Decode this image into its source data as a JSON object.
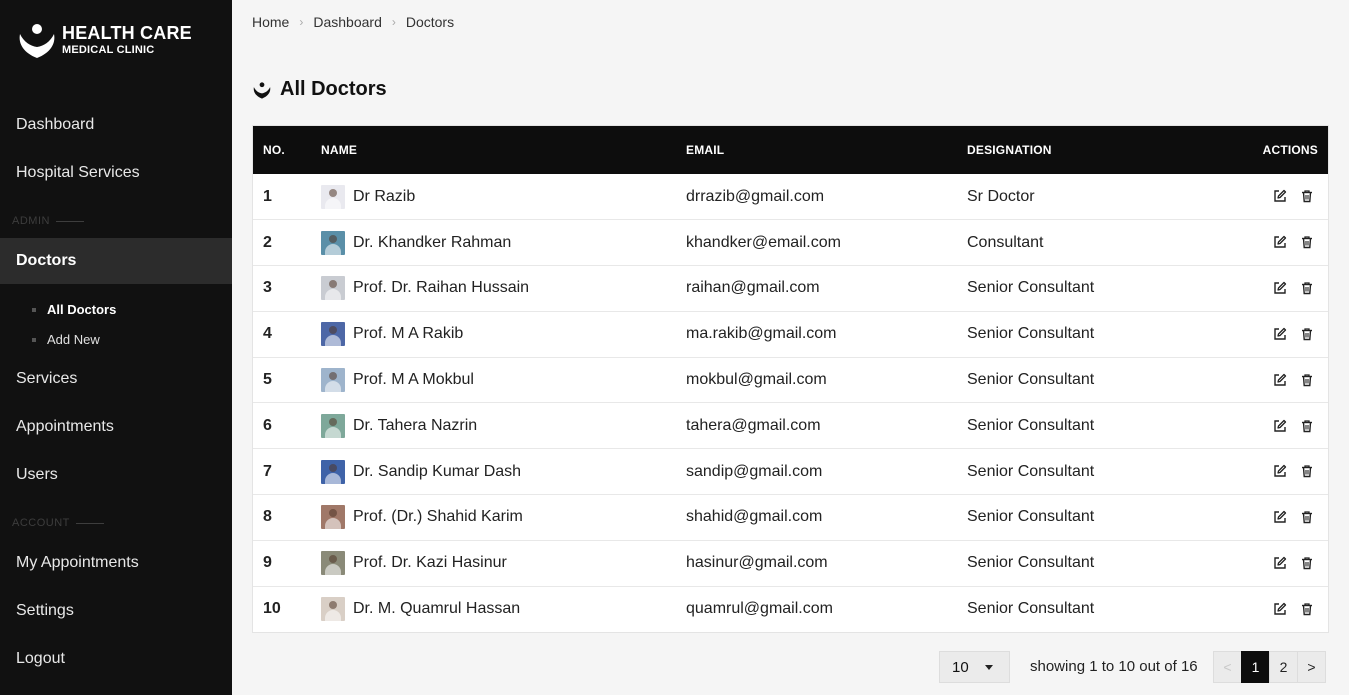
{
  "brand": {
    "title": "HEALTH CARE",
    "subtitle": "MEDICAL CLINIC"
  },
  "sidebar": {
    "items": [
      {
        "label": "Dashboard"
      },
      {
        "label": "Hospital Services"
      },
      {
        "section": "ADMIN"
      },
      {
        "label": "Doctors",
        "active": true
      },
      {
        "label": "Services"
      },
      {
        "label": "Appointments"
      },
      {
        "label": "Users"
      },
      {
        "section": "ACCOUNT"
      },
      {
        "label": "My Appointments"
      },
      {
        "label": "Settings"
      },
      {
        "label": "Logout"
      }
    ],
    "sub_items": [
      {
        "label": "All Doctors",
        "active": true
      },
      {
        "label": "Add New"
      }
    ]
  },
  "breadcrumb": [
    "Home",
    "Dashboard",
    "Doctors"
  ],
  "page": {
    "title": "All Doctors"
  },
  "table": {
    "headers": {
      "no": "NO.",
      "name": "NAME",
      "email": "EMAIL",
      "designation": "DESIGNATION",
      "actions": "ACTIONS"
    },
    "rows": [
      {
        "no": "1",
        "name": "Dr Razib",
        "email": "drrazib@gmail.com",
        "designation": "Sr Doctor",
        "avatar_color": "#e9e9ef"
      },
      {
        "no": "2",
        "name": "Dr. Khandker Rahman",
        "email": "khandker@email.com",
        "designation": "Consultant",
        "avatar_color": "#5a8fa8"
      },
      {
        "no": "3",
        "name": "Prof. Dr. Raihan Hussain",
        "email": "raihan@gmail.com",
        "designation": "Senior Consultant",
        "avatar_color": "#c9ccd2"
      },
      {
        "no": "4",
        "name": "Prof. M A Rakib",
        "email": "ma.rakib@gmail.com",
        "designation": "Senior Consultant",
        "avatar_color": "#4d67a6"
      },
      {
        "no": "5",
        "name": "Prof. M A Mokbul",
        "email": "mokbul@gmail.com",
        "designation": "Senior Consultant",
        "avatar_color": "#9eb4cc"
      },
      {
        "no": "6",
        "name": "Dr. Tahera Nazrin",
        "email": "tahera@gmail.com",
        "designation": "Senior Consultant",
        "avatar_color": "#7ea89a"
      },
      {
        "no": "7",
        "name": "Dr. Sandip Kumar Dash",
        "email": "sandip@gmail.com",
        "designation": "Senior Consultant",
        "avatar_color": "#3f63a8"
      },
      {
        "no": "8",
        "name": "Prof. (Dr.) Shahid Karim",
        "email": "shahid@gmail.com",
        "designation": "Senior Consultant",
        "avatar_color": "#a07868"
      },
      {
        "no": "9",
        "name": "Prof. Dr. Kazi Hasinur",
        "email": "hasinur@gmail.com",
        "designation": "Senior Consultant",
        "avatar_color": "#8a8a78"
      },
      {
        "no": "10",
        "name": "Dr. M. Quamrul Hassan",
        "email": "quamrul@gmail.com",
        "designation": "Senior Consultant",
        "avatar_color": "#d9cfc6"
      }
    ],
    "row_actions": [
      "edit-icon",
      "trash-icon"
    ]
  },
  "pagination": {
    "per_page": "10",
    "showing": "showing 1 to 10 out of 16",
    "prev": "<",
    "pages": [
      "1",
      "2"
    ],
    "current": "1",
    "next": ">"
  }
}
